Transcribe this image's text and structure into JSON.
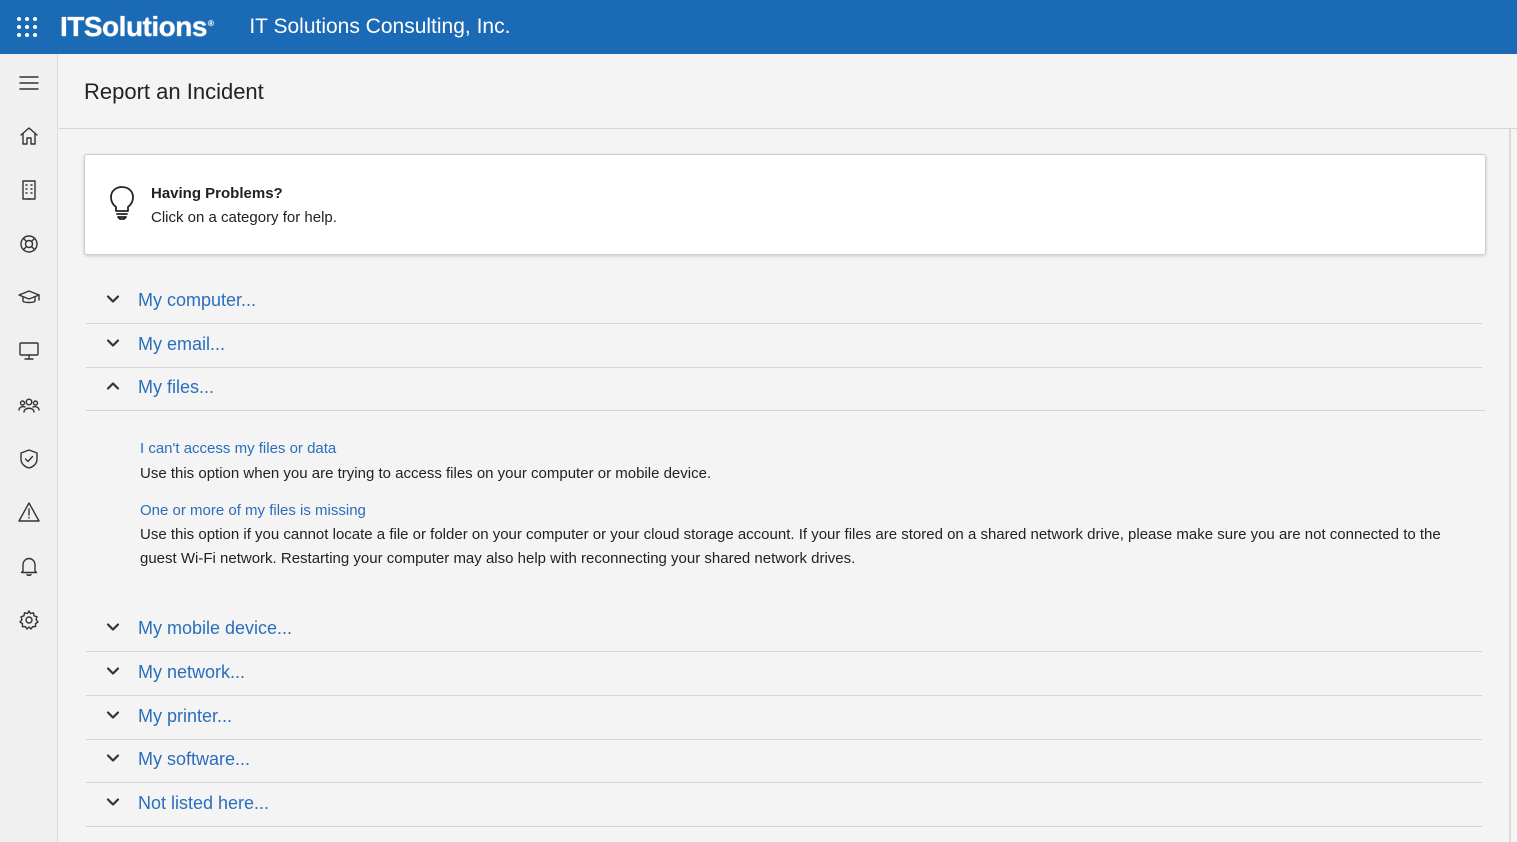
{
  "topbar": {
    "logo_text": "ITSolutions",
    "logo_tm": "®",
    "org_name": "IT Solutions Consulting, Inc.",
    "app_launcher_icon": "waffle-icon",
    "background": "#1b6ab5"
  },
  "rail": {
    "items": [
      {
        "icon": "hamburger-menu-icon"
      },
      {
        "icon": "home-icon"
      },
      {
        "icon": "building-icon"
      },
      {
        "icon": "lifebuoy-icon"
      },
      {
        "icon": "graduation-cap-icon"
      },
      {
        "icon": "monitor-icon"
      },
      {
        "icon": "people-icon"
      },
      {
        "icon": "shield-check-icon"
      },
      {
        "icon": "warning-icon"
      },
      {
        "icon": "bell-icon"
      },
      {
        "icon": "gear-icon"
      }
    ]
  },
  "page": {
    "title": "Report an Incident"
  },
  "info_card": {
    "icon": "lightbulb-icon",
    "title": "Having Problems?",
    "text": "Click on a category for help."
  },
  "accordion": {
    "link_color": "#2a6ebd",
    "categories": [
      {
        "label": "My computer...",
        "expanded": false
      },
      {
        "label": "My email...",
        "expanded": false
      },
      {
        "label": "My files...",
        "expanded": true
      },
      {
        "label": "My mobile device...",
        "expanded": false
      },
      {
        "label": "My network...",
        "expanded": false
      },
      {
        "label": "My printer...",
        "expanded": false
      },
      {
        "label": "My software...",
        "expanded": false
      },
      {
        "label": "Not listed here...",
        "expanded": false
      }
    ],
    "files_items": [
      {
        "title": "I can't access my files or data",
        "description": "Use this option when you are trying to access files on your computer or mobile device."
      },
      {
        "title": "One or more of my files is missing",
        "description": "Use this option if you cannot locate a file or folder on your computer or your cloud storage account. If your files are stored on a shared network drive, please make sure you are not connected to the guest Wi-Fi network. Restarting your computer may also help with reconnecting your shared network drives."
      }
    ]
  }
}
